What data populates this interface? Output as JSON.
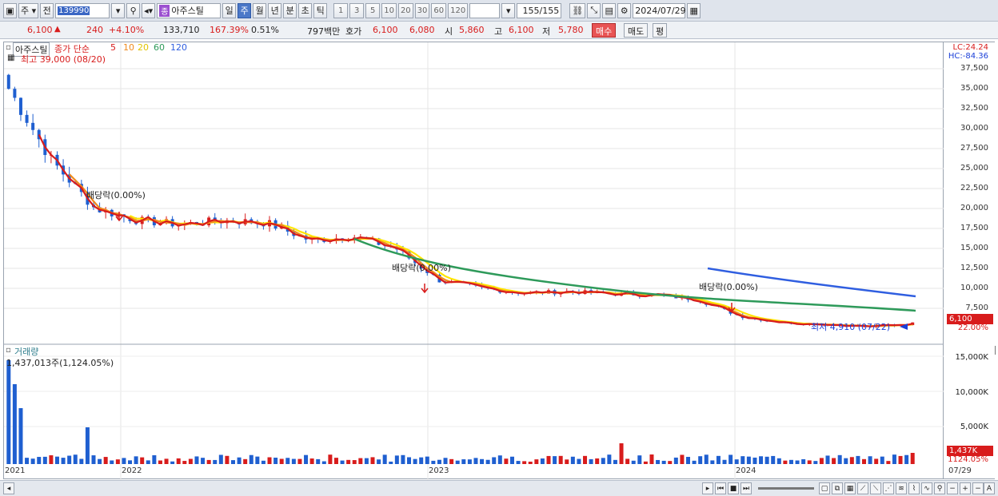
{
  "toolbar": {
    "market_type": "주",
    "prev_label": "전",
    "stock_code": "139990",
    "stock_badge": "종",
    "stock_name": "아주스틸",
    "periods": [
      "일",
      "주",
      "월",
      "년",
      "분",
      "초",
      "틱"
    ],
    "selected_period": "주",
    "intervals": [
      "1",
      "3",
      "5",
      "10",
      "20",
      "30",
      "60",
      "120"
    ],
    "count": "155",
    "count_total": "/155",
    "date": "2024/07/29"
  },
  "quote": {
    "price": "6,100",
    "change": "240",
    "change_pct": "+4.10%",
    "volume": "133,710",
    "volume_ratio": "167.39%",
    "turnover_pct": "0.51%",
    "amount": "797백만",
    "bid_ask_label": "호가",
    "ask": "6,100",
    "bid": "6,080",
    "open_label": "시",
    "open": "5,860",
    "high_label": "고",
    "high": "6,100",
    "low_label": "저",
    "low": "5,780",
    "buy_label": "매수",
    "sell_label": "매도",
    "eval_label": "평"
  },
  "chart": {
    "stock_name": "아주스틸",
    "ma_label": "종가 단순",
    "ma_periods": [
      "5",
      "10",
      "20",
      "60",
      "120"
    ],
    "max_note": "최고 39,000 (08/20)",
    "min_note": "최저 4,910 (07/22)",
    "dividend_note": "배당락(0.00%)",
    "lc": "LC:24.24",
    "hc": "HC:-84.36",
    "price_tag": "6,100",
    "pct_tag": "22.00%",
    "y_ticks": [
      "37,500",
      "35,000",
      "32,500",
      "30,000",
      "27,500",
      "25,000",
      "22,500",
      "20,000",
      "17,500",
      "15,000",
      "12,500",
      "10,000",
      "7,500"
    ],
    "x_ticks": [
      "2021",
      "2022",
      "2023",
      "2024"
    ],
    "x_end": "07/29",
    "volume_title": "거래량",
    "volume_note": "1,437,013주(1,124.05%)",
    "vol_ticks": [
      "15,000K",
      "10,000K",
      "5,000K"
    ],
    "vol_tag": "1,437K",
    "vol_pct_tag": "1124.05%"
  },
  "chart_data": {
    "type": "line",
    "title": "아주스틸",
    "x": [
      "2021-01",
      "2021-03",
      "2021-05",
      "2021-07",
      "2021-09",
      "2021-11",
      "2022-01",
      "2022-03",
      "2022-05",
      "2022-07",
      "2022-09",
      "2022-11",
      "2023-01",
      "2023-03",
      "2023-05",
      "2023-07",
      "2023-09",
      "2023-11",
      "2024-01",
      "2024-03",
      "2024-05",
      "2024-07"
    ],
    "series": [
      {
        "name": "5",
        "values": [
          35000,
          26000,
          20000,
          18500,
          18000,
          18500,
          18200,
          16000,
          16500,
          15000,
          11000,
          10000,
          9400,
          9600,
          9300,
          9200,
          8600,
          6500,
          5700,
          5500,
          5200,
          5600
        ]
      }
    ],
    "ylim": [
      4000,
      39000
    ]
  },
  "colors": {
    "up": "#d81c1c",
    "down": "#1f5fd0",
    "ma5": "#d81c1c",
    "ma10": "#f08a1c",
    "ma20": "#ffe600",
    "ma60": "#2e9a5a",
    "ma120": "#2f5ee0"
  }
}
